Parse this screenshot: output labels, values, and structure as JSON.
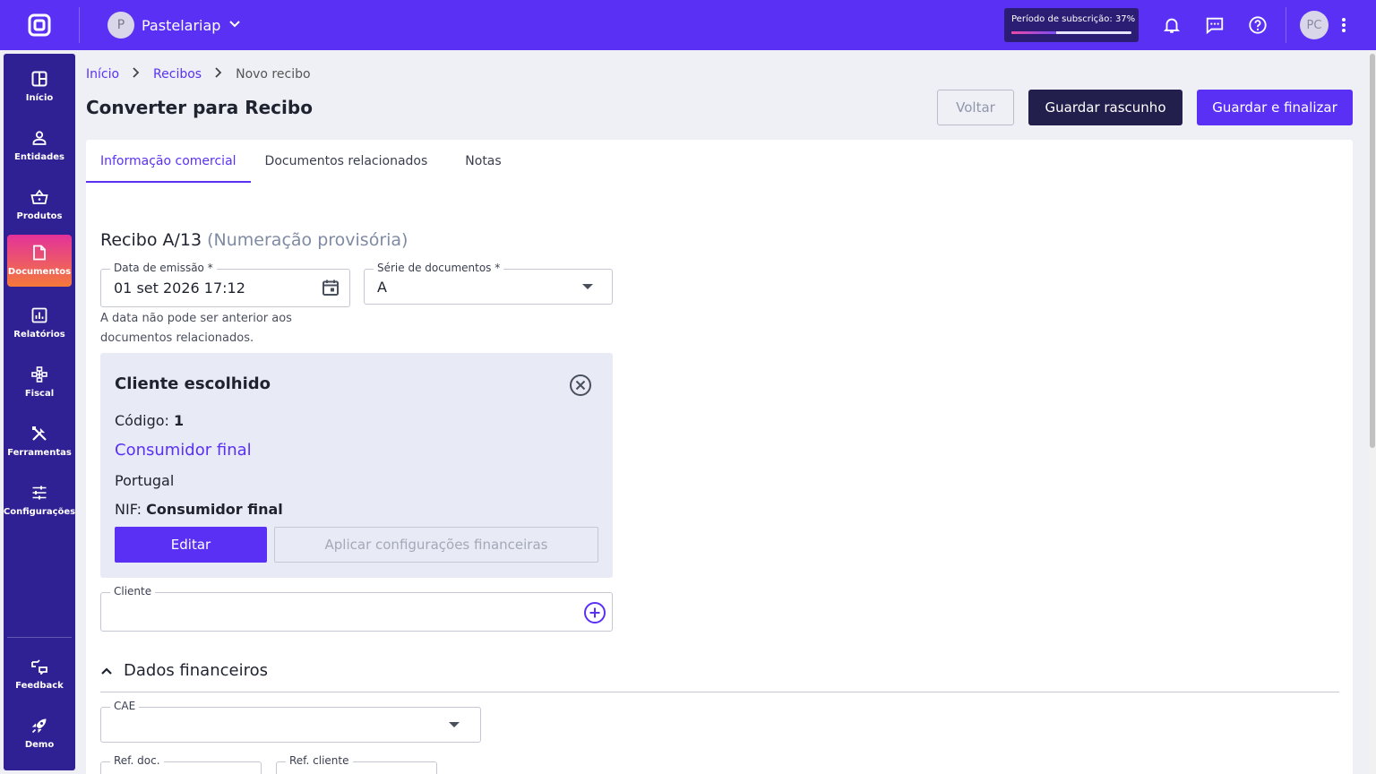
{
  "topbar": {
    "company_initial": "P",
    "company_name": "Pastelariap",
    "subscription_text": "Período de subscrição: 37%",
    "subscription_progress": 0.37,
    "user_initials": "PC"
  },
  "sidebar": {
    "items": [
      {
        "label": "Início",
        "icon": "grid-icon"
      },
      {
        "label": "Entidades",
        "icon": "person-icon"
      },
      {
        "label": "Produtos",
        "icon": "basket-icon"
      },
      {
        "label": "Documentos",
        "icon": "document-icon",
        "active": true
      },
      {
        "label": "Relatórios",
        "icon": "chart-icon"
      },
      {
        "label": "Fiscal",
        "icon": "hierarchy-icon"
      },
      {
        "label": "Ferramentas",
        "icon": "tools-icon"
      },
      {
        "label": "Configurações",
        "icon": "sliders-icon"
      },
      {
        "label": "Feedback",
        "icon": "feedback-icon"
      },
      {
        "label": "Demo",
        "icon": "rocket-icon"
      }
    ]
  },
  "breadcrumb": {
    "home": "Início",
    "receipts": "Recibos",
    "current": "Novo recibo"
  },
  "header": {
    "title": "Converter para Recibo",
    "back_label": "Voltar",
    "draft_label": "Guardar rascunho",
    "finalize_label": "Guardar e finalizar"
  },
  "tabs": [
    "Informação comercial",
    "Documentos relacionados",
    "Notas"
  ],
  "form": {
    "doc_title": "Recibo A/13",
    "doc_title_note": "(Numeração provisória)",
    "date_label": "Data de emissão *",
    "date_value": "01 set 2026 17:12",
    "series_label": "Série de documentos *",
    "series_value": "A",
    "date_hint": "A data não pode ser anterior aos documentos relacionados."
  },
  "client": {
    "title": "Cliente escolhido",
    "code_label": "Código:",
    "code_value": "1",
    "name": "Consumidor final",
    "country": "Portugal",
    "nif_label": "NIF:",
    "nif_value": "Consumidor final",
    "edit_label": "Editar",
    "apply_label": "Aplicar configurações financeiras",
    "field_label": "Cliente",
    "field_value": ""
  },
  "financial": {
    "section_title": "Dados financeiros",
    "cae_label": "CAE",
    "ref_doc_label": "Ref. doc.",
    "ref_client_label": "Ref. cliente"
  },
  "colors": {
    "brand": "#5a31f4",
    "sidebar": "#2f2094",
    "dark_button": "#231f4d"
  }
}
